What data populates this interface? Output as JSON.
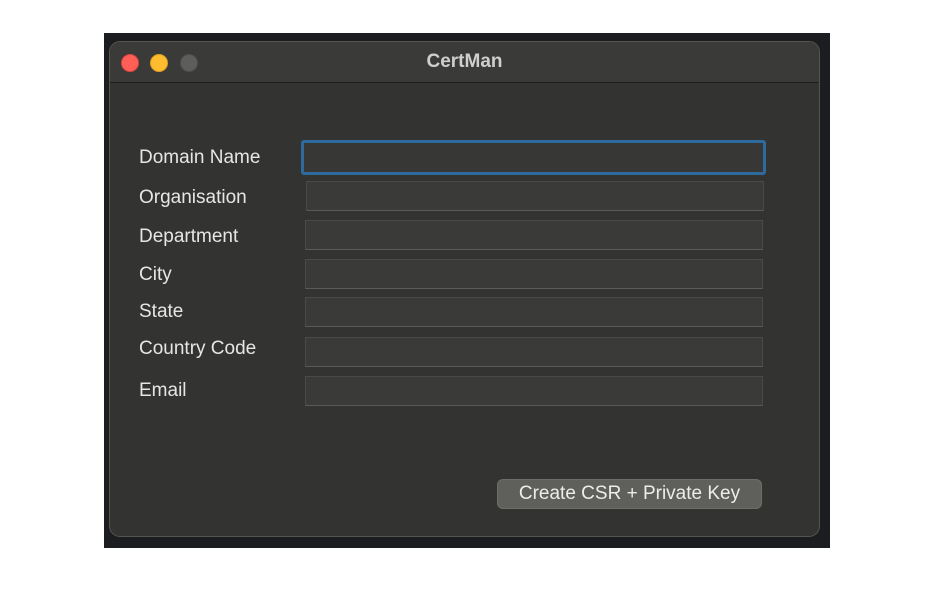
{
  "window": {
    "title": "CertMan",
    "controls": {
      "close": "close-button",
      "minimize": "minimize-button",
      "zoom": "zoom-button"
    }
  },
  "form": {
    "fields": [
      {
        "label": "Domain Name",
        "value": "",
        "placeholder": "",
        "focused": true
      },
      {
        "label": "Organisation",
        "value": "",
        "placeholder": ""
      },
      {
        "label": "Department",
        "value": "",
        "placeholder": ""
      },
      {
        "label": "City",
        "value": "",
        "placeholder": ""
      },
      {
        "label": "State",
        "value": "",
        "placeholder": ""
      },
      {
        "label": "Country Code",
        "value": "",
        "placeholder": ""
      },
      {
        "label": "Email",
        "value": "",
        "placeholder": ""
      }
    ],
    "submit_label": "Create CSR + Private Key"
  },
  "colors": {
    "close": "#ff5f57",
    "minimize": "#febc2e",
    "zoom_inactive": "#5d5d5b",
    "focus_ring": "#2f6a9f",
    "window_bg": "#333331"
  }
}
